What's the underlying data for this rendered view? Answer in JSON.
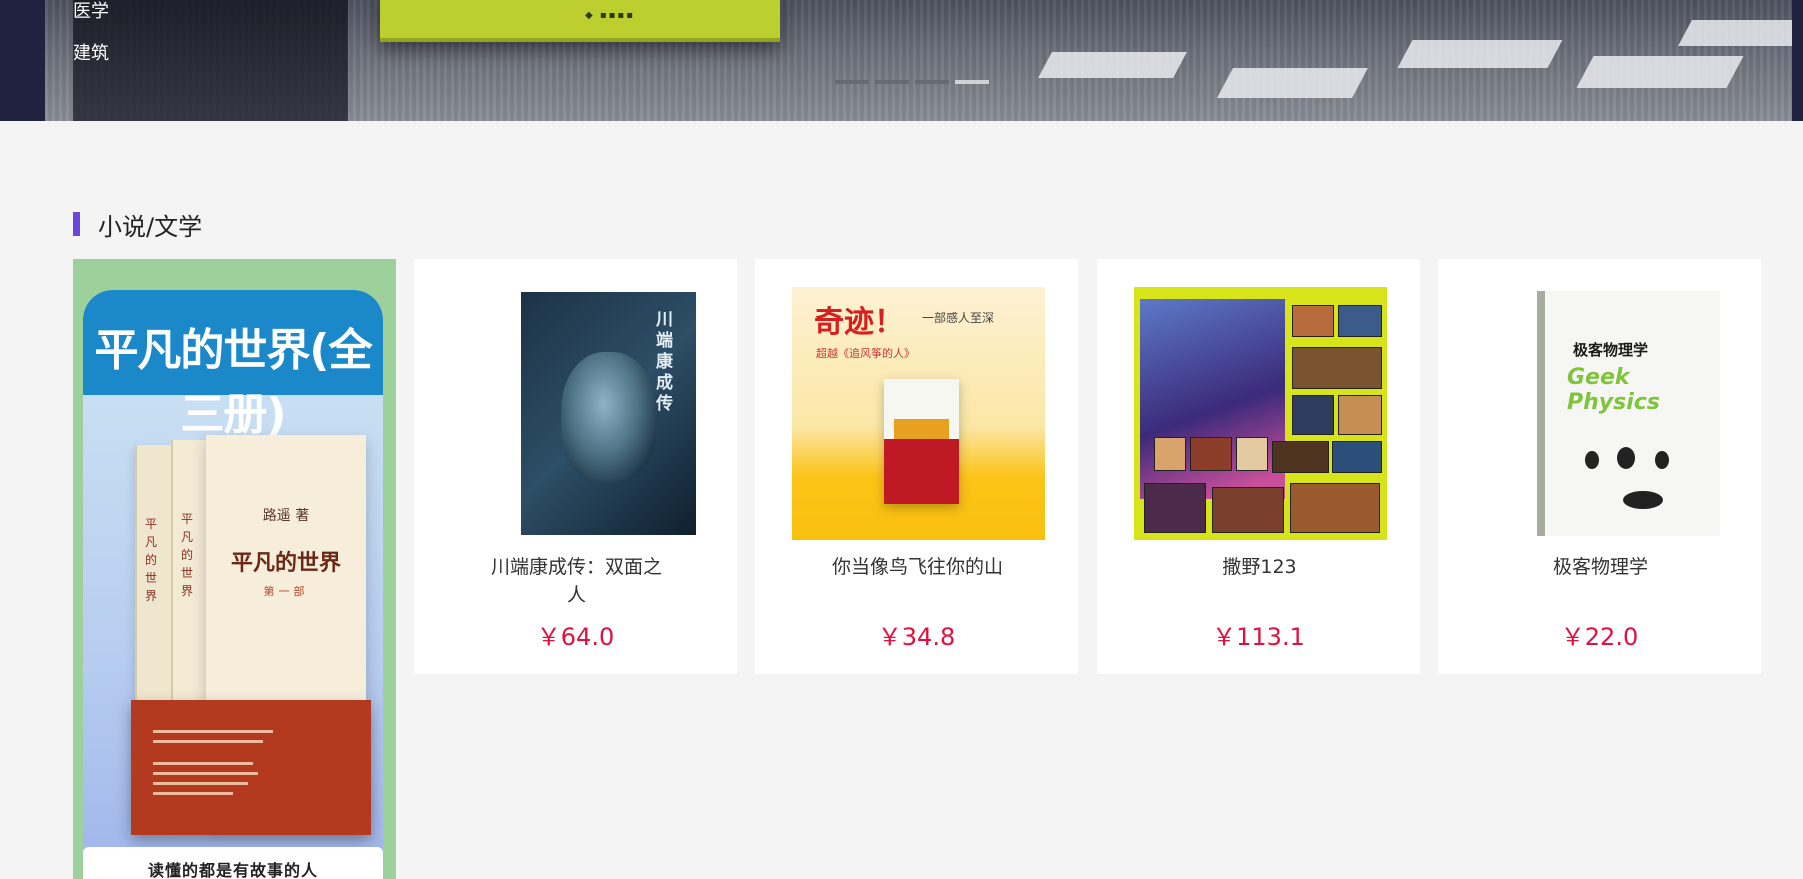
{
  "sidebar": {
    "categories": [
      {
        "label": "医学"
      },
      {
        "label": "建筑"
      }
    ]
  },
  "banner": {
    "slide_count": 4,
    "active_slide": 3
  },
  "section": {
    "title": "小说/文学",
    "accent_color": "#6b45e0"
  },
  "featured": {
    "title": "平凡的世界(全三册)",
    "cover": {
      "author": "路遥 著",
      "book_title": "平凡的世界",
      "volume": "第一部",
      "spine_title": "平凡的世界",
      "author_short": "路遥"
    },
    "caption": "读懂的都是有故事的人"
  },
  "products": [
    {
      "name": "川端康成传：双面之人",
      "price": "￥64.0",
      "cover_title": "川端康成传"
    },
    {
      "name": "你当像鸟飞往你的山",
      "price": "￥34.8",
      "cover_title": "奇迹！",
      "cover_sub": "一部感人至深",
      "cover_line": "超越《追风筝的人》"
    },
    {
      "name": "撒野123",
      "price": "￥113.1"
    },
    {
      "name": "极客物理学",
      "price": "￥22.0",
      "cover_title": "极客物理学",
      "cover_eng": "Geek Physics"
    }
  ],
  "colors": {
    "price": "#e1103d",
    "page_bg": "#f4f4f4"
  }
}
